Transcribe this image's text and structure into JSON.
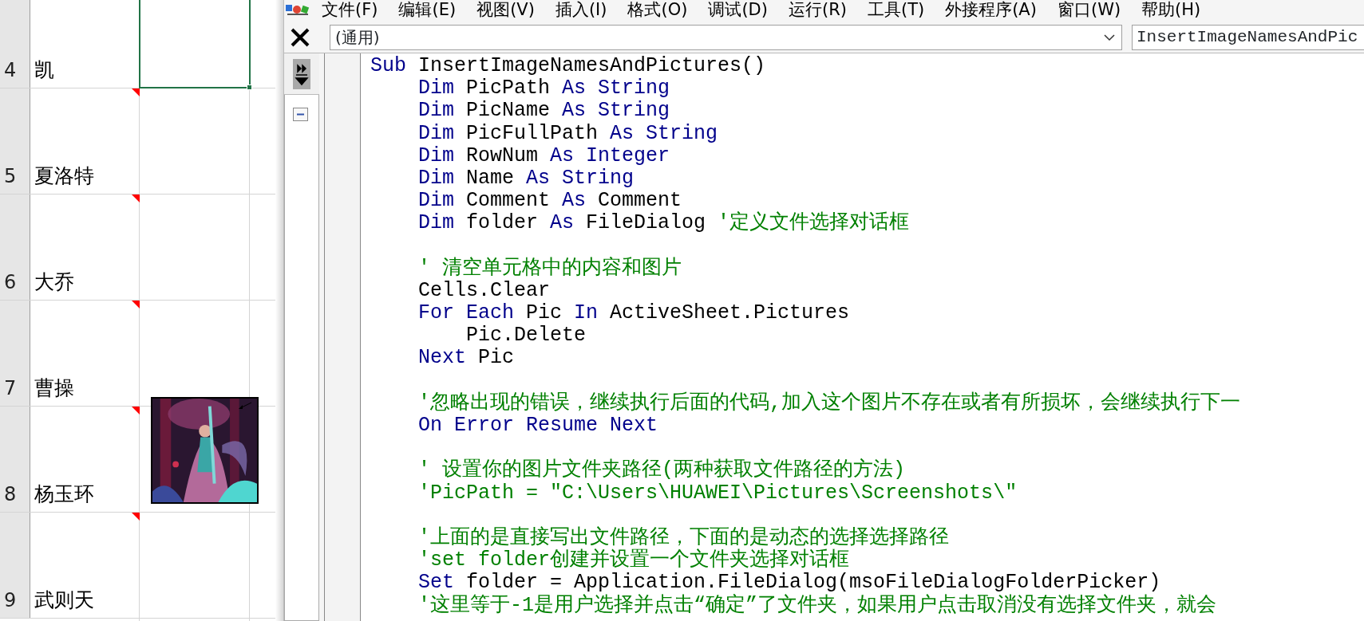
{
  "sheet": {
    "rows": [
      {
        "number": "4",
        "name": "凯",
        "comment": false,
        "selected": true,
        "comment_shown": false
      },
      {
        "number": "5",
        "name": "夏洛特",
        "comment": true,
        "selected": false,
        "comment_shown": false
      },
      {
        "number": "6",
        "name": "大乔",
        "comment": true,
        "selected": false,
        "comment_shown": false
      },
      {
        "number": "7",
        "name": "曹操",
        "comment": true,
        "selected": false,
        "comment_shown": false
      },
      {
        "number": "8",
        "name": "杨玉环",
        "comment": true,
        "selected": false,
        "comment_shown": true
      },
      {
        "number": "9",
        "name": "武则天",
        "comment": true,
        "selected": false,
        "comment_shown": false
      }
    ]
  },
  "vba": {
    "menu": [
      "文件(F)",
      "编辑(E)",
      "视图(V)",
      "插入(I)",
      "格式(O)",
      "调试(D)",
      "运行(R)",
      "工具(T)",
      "外接程序(A)",
      "窗口(W)",
      "帮助(H)"
    ],
    "object_combo": "(通用)",
    "procedure_combo": "InsertImageNamesAndPic",
    "code": [
      {
        "kind": "code",
        "tokens": [
          {
            "kind": "keyword",
            "text": "Sub"
          },
          {
            "kind": "plain",
            "text": " InsertImageNamesAndPictures()"
          }
        ]
      },
      {
        "kind": "code",
        "tokens": [
          {
            "kind": "keyword",
            "text": "    Dim"
          },
          {
            "kind": "plain",
            "text": " PicPath "
          },
          {
            "kind": "keyword",
            "text": "As String"
          }
        ]
      },
      {
        "kind": "code",
        "tokens": [
          {
            "kind": "keyword",
            "text": "    Dim"
          },
          {
            "kind": "plain",
            "text": " PicName "
          },
          {
            "kind": "keyword",
            "text": "As String"
          }
        ]
      },
      {
        "kind": "code",
        "tokens": [
          {
            "kind": "keyword",
            "text": "    Dim"
          },
          {
            "kind": "plain",
            "text": " PicFullPath "
          },
          {
            "kind": "keyword",
            "text": "As String"
          }
        ]
      },
      {
        "kind": "code",
        "tokens": [
          {
            "kind": "keyword",
            "text": "    Dim"
          },
          {
            "kind": "plain",
            "text": " RowNum "
          },
          {
            "kind": "keyword",
            "text": "As Integer"
          }
        ]
      },
      {
        "kind": "code",
        "tokens": [
          {
            "kind": "keyword",
            "text": "    Dim"
          },
          {
            "kind": "plain",
            "text": " Name "
          },
          {
            "kind": "keyword",
            "text": "As String"
          }
        ]
      },
      {
        "kind": "code",
        "tokens": [
          {
            "kind": "keyword",
            "text": "    Dim"
          },
          {
            "kind": "plain",
            "text": " Comment "
          },
          {
            "kind": "keyword",
            "text": "As"
          },
          {
            "kind": "plain",
            "text": " Comment"
          }
        ]
      },
      {
        "kind": "code",
        "tokens": [
          {
            "kind": "keyword",
            "text": "    Dim"
          },
          {
            "kind": "plain",
            "text": " folder "
          },
          {
            "kind": "keyword",
            "text": "As"
          },
          {
            "kind": "plain",
            "text": " FileDialog "
          },
          {
            "kind": "comment",
            "text": "'定义文件选择对话框"
          }
        ]
      },
      {
        "kind": "blank"
      },
      {
        "kind": "code",
        "tokens": [
          {
            "kind": "comment",
            "text": "    ' 清空单元格中的内容和图片"
          }
        ]
      },
      {
        "kind": "code",
        "tokens": [
          {
            "kind": "plain",
            "text": "    Cells.Clear"
          }
        ]
      },
      {
        "kind": "code",
        "tokens": [
          {
            "kind": "keyword",
            "text": "    For Each"
          },
          {
            "kind": "plain",
            "text": " Pic "
          },
          {
            "kind": "keyword",
            "text": "In"
          },
          {
            "kind": "plain",
            "text": " ActiveSheet.Pictures"
          }
        ]
      },
      {
        "kind": "code",
        "tokens": [
          {
            "kind": "plain",
            "text": "        Pic.Delete"
          }
        ]
      },
      {
        "kind": "code",
        "tokens": [
          {
            "kind": "keyword",
            "text": "    Next"
          },
          {
            "kind": "plain",
            "text": " Pic"
          }
        ]
      },
      {
        "kind": "blank"
      },
      {
        "kind": "code",
        "tokens": [
          {
            "kind": "comment",
            "text": "    '忽略出现的错误，继续执行后面的代码,加入这个图片不存在或者有所损坏，会继续执行下一"
          }
        ]
      },
      {
        "kind": "code",
        "tokens": [
          {
            "kind": "keyword",
            "text": "    On Error Resume Next"
          }
        ]
      },
      {
        "kind": "blank"
      },
      {
        "kind": "code",
        "tokens": [
          {
            "kind": "comment",
            "text": "    ' 设置你的图片文件夹路径(两种获取文件路径的方法)"
          }
        ]
      },
      {
        "kind": "code",
        "tokens": [
          {
            "kind": "comment",
            "text": "    'PicPath = \"C:\\Users\\HUAWEI\\Pictures\\Screenshots\\\""
          }
        ]
      },
      {
        "kind": "blank"
      },
      {
        "kind": "code",
        "tokens": [
          {
            "kind": "comment",
            "text": "    '上面的是直接写出文件路径，下面的是动态的选择选择路径"
          }
        ]
      },
      {
        "kind": "code",
        "tokens": [
          {
            "kind": "comment",
            "text": "    'set folder创建并设置一个文件夹选择对话框"
          }
        ]
      },
      {
        "kind": "code",
        "tokens": [
          {
            "kind": "keyword",
            "text": "    Set"
          },
          {
            "kind": "plain",
            "text": " folder = Application.FileDialog(msoFileDialogFolderPicker)"
          }
        ]
      },
      {
        "kind": "code",
        "tokens": [
          {
            "kind": "comment",
            "text": "    '这里等于-1是用户选择并点击“确定”了文件夹，如果用户点击取消没有选择文件夹，就会"
          }
        ]
      }
    ]
  }
}
